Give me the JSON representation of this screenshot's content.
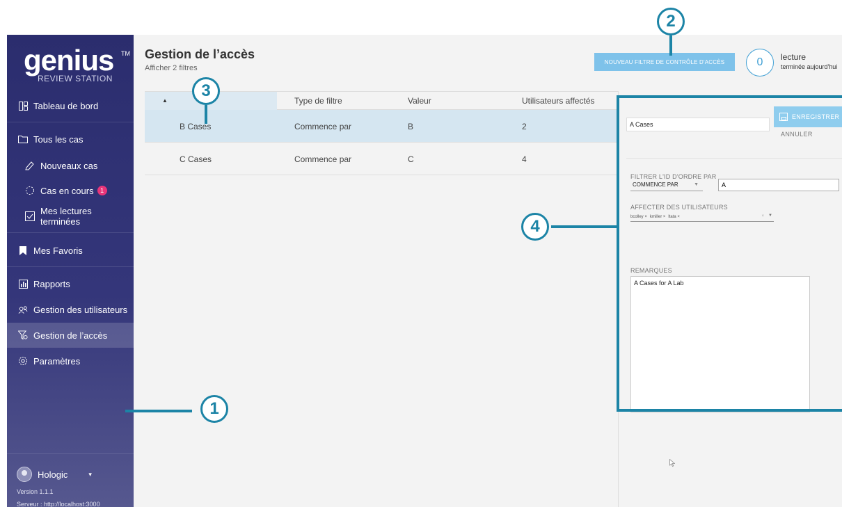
{
  "app": {
    "logo_text": "genius",
    "logo_tm": "TM",
    "logo_subtitle": "REVIEW STATION"
  },
  "sidebar": {
    "items": [
      {
        "label": "Tableau de bord",
        "icon": "dashboard-icon"
      },
      {
        "label": "Tous les cas",
        "icon": "folder-icon"
      },
      {
        "label": "Nouveaux cas",
        "icon": "new-case-icon"
      },
      {
        "label": "Cas en cours",
        "icon": "in-progress-icon",
        "badge": "1"
      },
      {
        "label": "Mes lectures terminées",
        "icon": "checkbox-icon"
      },
      {
        "label": "Mes Favoris",
        "icon": "bookmark-icon"
      },
      {
        "label": "Rapports",
        "icon": "chart-icon"
      },
      {
        "label": "Gestion des utilisateurs",
        "icon": "users-icon"
      },
      {
        "label": "Gestion de l’accès",
        "icon": "filter-icon",
        "active": true
      },
      {
        "label": "Paramètres",
        "icon": "gear-icon"
      }
    ],
    "user": {
      "name": "Hologic",
      "version": "Version 1.1.1",
      "server": "Serveur : http://localhost:3000"
    }
  },
  "header": {
    "title": "Gestion de l’accès",
    "subtitle": "Afficher 2 filtres",
    "new_filter_button": "NOUVEAU FILTRE DE CONTRÔLE D'ACCÈS",
    "count": "0",
    "count_label": "lecture",
    "count_sublabel": "terminée aujourd'hui"
  },
  "table": {
    "columns": [
      "",
      "Type de filtre",
      "Valeur",
      "Utilisateurs affectés"
    ],
    "rows": [
      {
        "name": "B Cases",
        "type": "Commence par",
        "value": "B",
        "users": "2",
        "selected": true
      },
      {
        "name": "C Cases",
        "type": "Commence par",
        "value": "C",
        "users": "4",
        "selected": false
      }
    ]
  },
  "edit_panel": {
    "name_value": "A Cases",
    "save_button": "ENREGISTRER",
    "cancel_button": "ANNULER",
    "filter_label": "FILTRER L'ID D'ORDRE PAR",
    "filter_operator": "COMMENCE PAR",
    "filter_value": "A",
    "assign_label": "AFFECTER DES UTILISATEURS",
    "assigned_users": [
      "bcolley",
      "kmiller",
      "ltata"
    ],
    "notes_label": "REMARQUES",
    "notes_value": "A Cases for A Lab"
  },
  "callouts": [
    "1",
    "2",
    "3",
    "4"
  ],
  "colors": {
    "callout": "#1c84a6",
    "sidebar": "#2b2d6e",
    "accent_button": "#7ec2ea",
    "badge": "#e8357a",
    "selected_row": "#d5e6f1"
  }
}
